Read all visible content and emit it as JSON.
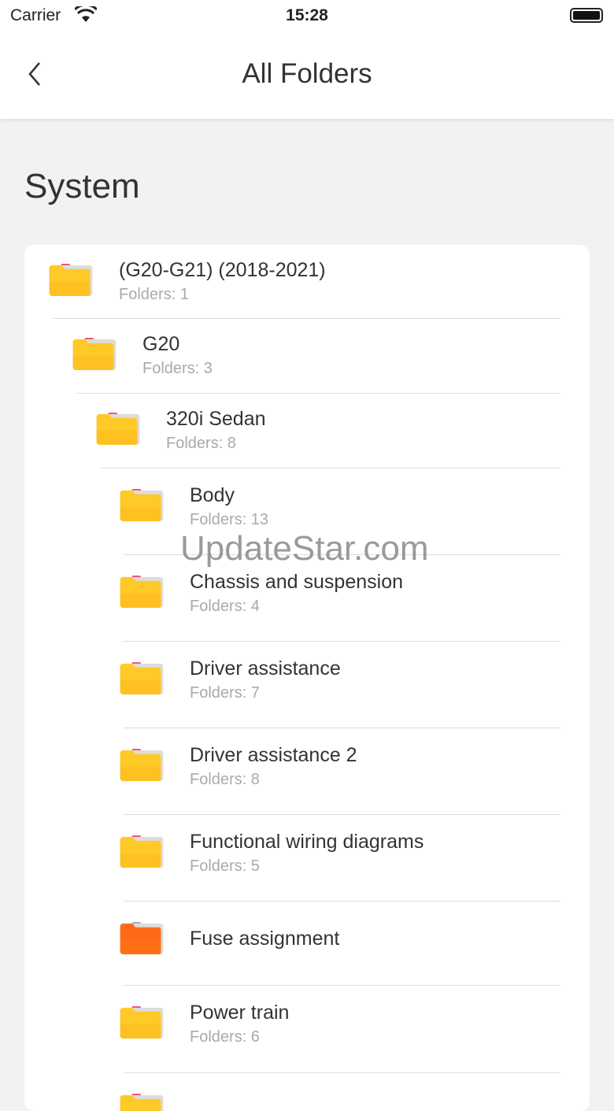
{
  "status": {
    "carrier": "Carrier",
    "time": "15:28"
  },
  "nav": {
    "title": "All Folders"
  },
  "section": "System",
  "watermark": "UpdateStar.com",
  "colors": {
    "folder": "#ffc928",
    "folder_special": "#ff6a1a",
    "tab": "#f0506e"
  },
  "items": [
    {
      "name": "(G20-G21) (2018-2021)",
      "sub": "Folders: 1",
      "level": 0,
      "h": 94
    },
    {
      "name": "G20",
      "sub": "Folders: 3",
      "level": 1,
      "h": 95
    },
    {
      "name": "320i Sedan",
      "sub": "Folders: 8",
      "level": 2,
      "h": 95
    },
    {
      "name": "Body",
      "sub": "Folders: 13",
      "level": 3,
      "h": 110
    },
    {
      "name": "Chassis and suspension",
      "sub": "Folders: 4",
      "level": 3,
      "h": 110
    },
    {
      "name": "Driver assistance",
      "sub": "Folders: 7",
      "level": 3,
      "h": 110
    },
    {
      "name": "Driver assistance 2",
      "sub": "Folders: 8",
      "level": 3,
      "h": 110
    },
    {
      "name": "Functional wiring diagrams",
      "sub": "Folders: 5",
      "level": 3,
      "h": 110
    },
    {
      "name": "Fuse assignment",
      "sub": "",
      "level": 3,
      "h": 107,
      "special": true
    },
    {
      "name": "Power train",
      "sub": "Folders: 6",
      "level": 3,
      "h": 111
    },
    {
      "name": "",
      "sub": "",
      "level": 3,
      "h": 110
    }
  ]
}
